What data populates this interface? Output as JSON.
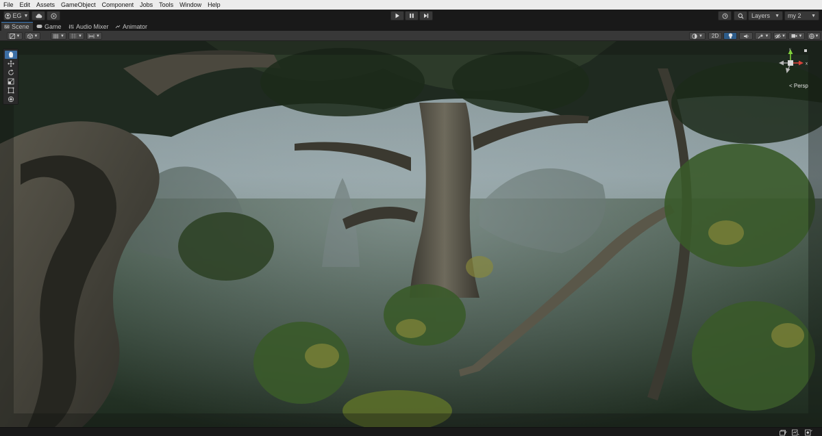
{
  "menu": [
    "File",
    "Edit",
    "Assets",
    "GameObject",
    "Component",
    "Jobs",
    "Tools",
    "Window",
    "Help"
  ],
  "toolbar": {
    "account_label": "EG",
    "layers_label": "Layers",
    "layout_label": "my 2",
    "icons": [
      "account-icon",
      "cloud-icon",
      "collab-icon",
      "play-icon",
      "pause-icon",
      "step-icon",
      "history-icon",
      "search-icon"
    ]
  },
  "tabs": [
    {
      "label": "Scene",
      "icon": "scene-icon",
      "active": true
    },
    {
      "label": "Game",
      "icon": "game-icon",
      "active": false
    },
    {
      "label": "Audio Mixer",
      "icon": "audio-mixer-icon",
      "active": false
    },
    {
      "label": "Animator",
      "icon": "animator-icon",
      "active": false
    }
  ],
  "scene_toolbar": {
    "two_d_label": "2D"
  },
  "tools": [
    "hand-tool-icon",
    "move-tool-icon",
    "rotate-tool-icon",
    "scale-tool-icon",
    "rect-tool-icon",
    "transform-tool-icon"
  ],
  "gizmo": {
    "x_label": "x",
    "y_label": "y",
    "projection_label": "< Persp"
  },
  "colors": {
    "accent": "#3d6fa5",
    "gizmo_x": "#d9423a",
    "gizmo_y": "#7fd13a",
    "gizmo_z": "#3a7fd9"
  }
}
